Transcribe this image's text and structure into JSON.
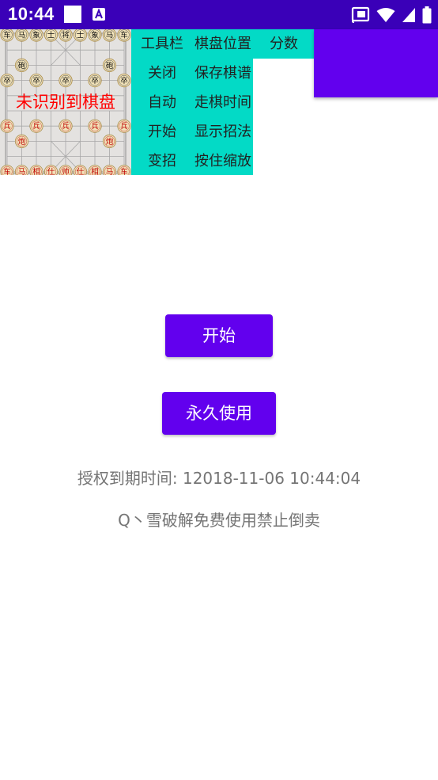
{
  "status_bar": {
    "time": "10:44",
    "icons": [
      "white-square-icon",
      "a-notification-icon",
      "cast-icon",
      "wifi-icon",
      "signal-icon",
      "battery-icon"
    ],
    "background": "#3a00b8"
  },
  "board": {
    "overlay_text": "未识别到棋盘",
    "overlay_color": "#ff0000",
    "top_row": [
      "车",
      "马",
      "象",
      "士",
      "将",
      "士",
      "象",
      "马",
      "车"
    ],
    "cannons_top": [
      "砲",
      "砲"
    ],
    "soldiers_top": [
      "卒",
      "卒",
      "卒",
      "卒",
      "卒"
    ],
    "soldiers_bottom": [
      "兵",
      "兵",
      "兵",
      "兵",
      "兵"
    ],
    "cannons_bottom": [
      "炮",
      "炮"
    ],
    "bottom_row": [
      "车",
      "马",
      "相",
      "仕",
      "帅",
      "仕",
      "相",
      "马",
      "车"
    ]
  },
  "menu": {
    "items": [
      {
        "label": "工具栏"
      },
      {
        "label": "棋盘位置"
      },
      {
        "label": "分数"
      },
      {
        "label": "关闭"
      },
      {
        "label": "保存棋谱"
      },
      {
        "label": "自动"
      },
      {
        "label": "走棋时间"
      },
      {
        "label": "开始"
      },
      {
        "label": "显示招法"
      },
      {
        "label": "变招"
      },
      {
        "label": "按住缩放"
      }
    ],
    "background": "#03dac6",
    "accent": "#6200ee"
  },
  "main": {
    "start_button": "开始",
    "forever_button": "永久使用",
    "expire_text": "授权到期时间: 12018-11-06 10:44:04",
    "crack_text": "Q丶雪破解免费使用禁止倒卖"
  }
}
